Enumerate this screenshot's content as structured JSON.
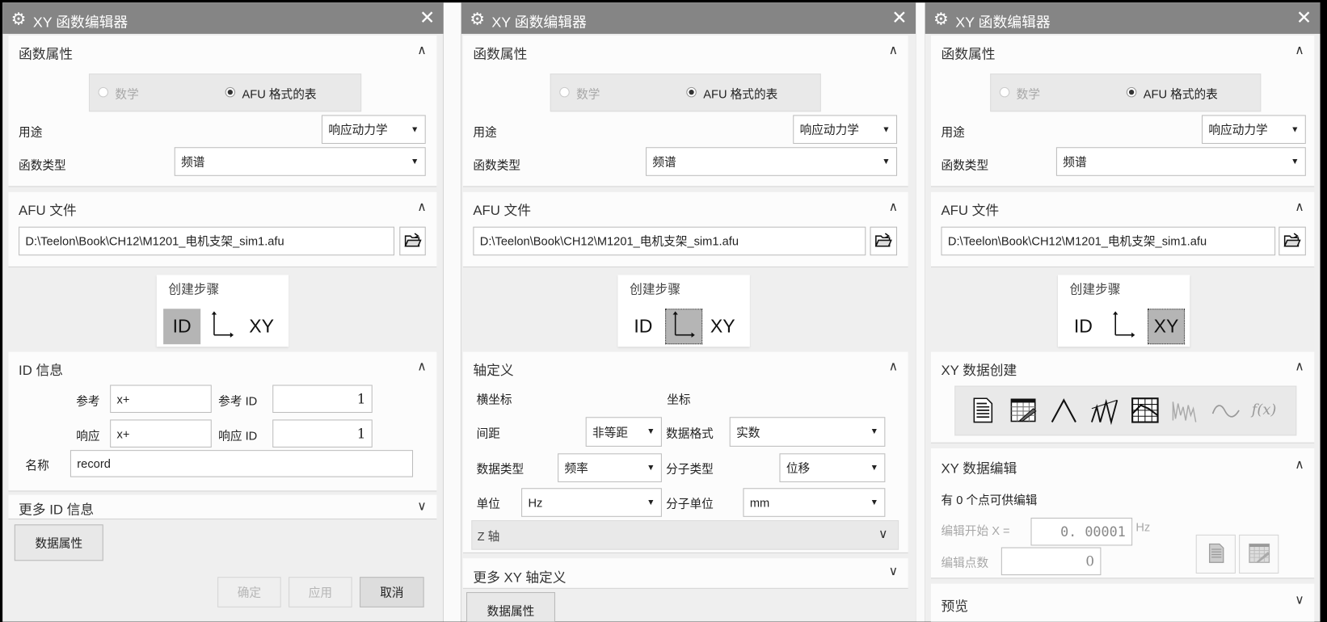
{
  "window_title": "XY 函数编辑器",
  "common": {
    "func_props_header": "函数属性",
    "radio_math": "数学",
    "radio_afu": "AFU 格式的表",
    "usage_label": "用途",
    "usage_value": "响应动力学",
    "type_label": "函数类型",
    "type_value": "频谱",
    "afu_header": "AFU 文件",
    "afu_path": "D:\\Teelon\\Book\\CH12\\M1201_电机支架_sim1.afu",
    "steps_label": "创建步骤",
    "step_id": "ID",
    "step_xy": "XY",
    "data_props": "数据属性"
  },
  "panel1": {
    "selected_step": "ID",
    "id_header": "ID 信息",
    "ref_label": "参考",
    "ref_value": "x+",
    "ref_id_label": "参考 ID",
    "ref_id_value": "1",
    "resp_label": "响应",
    "resp_value": "x+",
    "resp_id_label": "响应 ID",
    "resp_id_value": "1",
    "name_label": "名称",
    "name_value": "record",
    "more_id_header": "更多 ID 信息",
    "ok": "确定",
    "apply": "应用",
    "cancel": "取消"
  },
  "panel2": {
    "selected_step": "axis",
    "axis_header": "轴定义",
    "abscissa": "横坐标",
    "ordinate": "坐标",
    "spacing_label": "间距",
    "spacing_value": "非等距",
    "data_format_label": "数据格式",
    "data_format_value": "实数",
    "data_type_label": "数据类型",
    "data_type_value": "频率",
    "numerator_type_label": "分子类型",
    "numerator_type_value": "位移",
    "unit_label": "单位",
    "unit_value": "Hz",
    "numerator_unit_label": "分子单位",
    "numerator_unit_value": "mm",
    "z_axis": "Z 轴",
    "more_xy_header": "更多 XY 轴定义"
  },
  "panel3": {
    "selected_step": "XY",
    "create_header": "XY 数据创建",
    "tools": [
      "text-editor-icon",
      "spreadsheet-icon",
      "single-peak-icon",
      "multi-peak-icon",
      "grid-plot-icon",
      "random-wave-icon",
      "sine-wave-icon",
      "function-fx-icon"
    ],
    "fx_label": "f(x)",
    "edit_header": "XY 数据编辑",
    "points_text": "有 0 个点可供编辑",
    "edit_start_label": "编辑开始 X =",
    "edit_start_value": "0. 00001",
    "edit_start_unit": "Hz",
    "edit_count_label": "编辑点数",
    "edit_count_value": "0",
    "preview_header": "预览"
  }
}
